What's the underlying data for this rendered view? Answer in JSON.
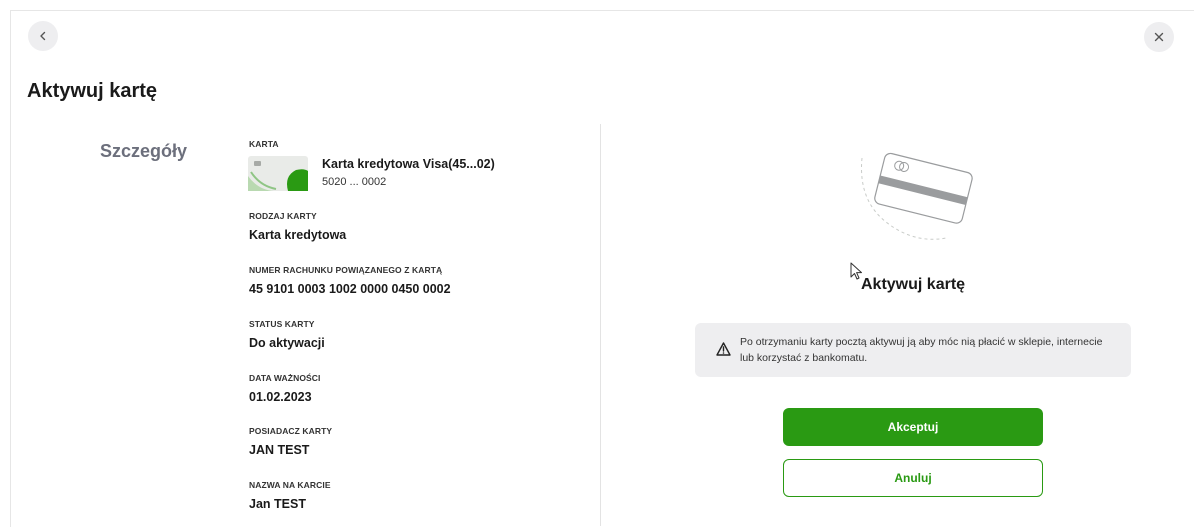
{
  "header": {
    "back_icon": "chevron-left-icon",
    "close_icon": "close-icon",
    "title": "Aktywuj kartę"
  },
  "details": {
    "section_label": "Szczegóły",
    "card": {
      "label": "KARTA",
      "name": "Karta kredytowa Visa(45...02)",
      "number": "5020 ... 0002"
    },
    "fields": [
      {
        "label": "RODZAJ KARTY",
        "value": "Karta kredytowa"
      },
      {
        "label": "NUMER RACHUNKU POWIĄZANEGO Z KARTĄ",
        "value": "45 9101 0003 1002 0000 0450 0002"
      },
      {
        "label": "STATUS KARTY",
        "value": "Do aktywacji"
      },
      {
        "label": "DATA WAŻNOŚCI",
        "value": "01.02.2023"
      },
      {
        "label": "POSIADACZ KARTY",
        "value": "JAN TEST"
      },
      {
        "label": "NAZWA NA KARCIE",
        "value": "Jan TEST"
      }
    ]
  },
  "activation": {
    "title": "Aktywuj kartę",
    "info_text": "Po otrzymaniu karty pocztą aktywuj ją aby móc nią płacić w sklepie, internecie lub korzystać z bankomatu.",
    "accept_label": "Akceptuj",
    "cancel_label": "Anuluj"
  },
  "colors": {
    "accent_green": "#2a9a13",
    "info_bg": "#eeeef0",
    "section_label": "#6c6f7c"
  }
}
